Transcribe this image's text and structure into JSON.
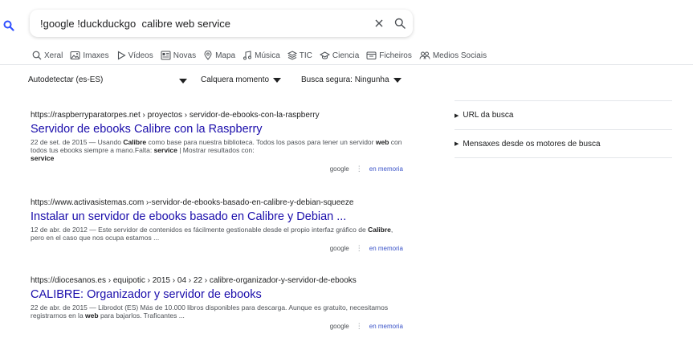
{
  "search": {
    "query": "!google !duckduckgo  calibre web service",
    "clear_icon": "close-icon",
    "search_icon": "search-icon"
  },
  "tabs": [
    {
      "label": "Xeral",
      "icon": "search-icon"
    },
    {
      "label": "Imaxes",
      "icon": "image-icon"
    },
    {
      "label": "Vídeos",
      "icon": "play-icon"
    },
    {
      "label": "Novas",
      "icon": "newspaper-icon"
    },
    {
      "label": "Mapa",
      "icon": "map-pin-icon"
    },
    {
      "label": "Música",
      "icon": "music-note-icon"
    },
    {
      "label": "TIC",
      "icon": "chip-icon"
    },
    {
      "label": "Ciencia",
      "icon": "graduation-cap-icon"
    },
    {
      "label": "Ficheiros",
      "icon": "folder-icon"
    },
    {
      "label": "Medios Sociais",
      "icon": "people-icon"
    }
  ],
  "filters": {
    "language": "Autodetectar (es-ES)",
    "time": "Calquera momento",
    "safe": "Busca segura: Ningunha"
  },
  "results": [
    {
      "url": "https://raspberryparatorpes.net  › proyectos › servidor-de-ebooks-con-la-raspberry",
      "title": "Servidor de ebooks Calibre con la Raspberry",
      "snippet_parts": [
        "22 de set. de 2015 — Usando ",
        "Calibre",
        " como base para nuestra biblioteca. Todos los pasos para tener un servidor ",
        "web",
        " con todos tus ebooks siempre a mano.Falta: ",
        "service",
        " | Mostrar resultados con: ",
        "service",
        ""
      ],
      "engine": "google",
      "cache": "en memoria"
    },
    {
      "url": "https://www.activasistemas.com  ›-servidor-de-ebooks-basado-en-calibre-y-debian-squeeze",
      "title": "Instalar un servidor de ebooks basado en Calibre y Debian ...",
      "snippet_parts": [
        "12 de abr. de 2012 — Este servidor de contenidos es fácilmente gestionable desde el propio interfaz gráfico de ",
        "Calibre",
        ", pero en el caso que nos ocupa estamos ..."
      ],
      "engine": "google",
      "cache": "en memoria"
    },
    {
      "url": "https://diocesanos.es  › equipotic › 2015 › 04 › 22 › calibre-organizador-y-servidor-de-ebooks",
      "title": "CALIBRE: Organizador y servidor de ebooks",
      "snippet_parts": [
        "22 de abr. de 2015 — Librodot (ES) Más de 10.000 libros disponibles para descarga. Aunque es gratuito, necesitamos registrarnos en la ",
        "web",
        " para bajarlos. Traficantes ..."
      ],
      "engine": "google",
      "cache": "en memoria"
    }
  ],
  "sidebar": {
    "items": [
      {
        "label": "URL da busca"
      },
      {
        "label": "Mensaxes desde os motores de busca"
      }
    ]
  },
  "colors": {
    "accent": "#3050ff",
    "link": "#1a0dab",
    "cache_link": "#3a53c8"
  }
}
